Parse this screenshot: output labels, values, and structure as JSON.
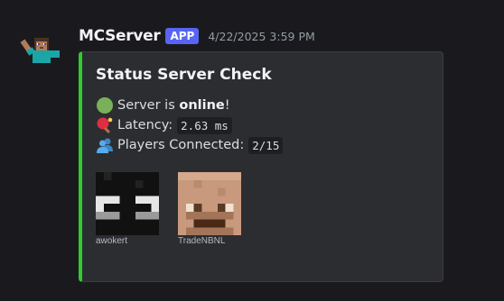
{
  "message": {
    "username": "MCServer",
    "badge": "APP",
    "timestamp": "4/22/2025 3:59 PM",
    "avatar_icon": "minecraft-steve-waving-icon"
  },
  "embed": {
    "accent_color": "#2ecc2f",
    "title": "Status Server Check",
    "status": {
      "icon": "green-circle-emoji",
      "prefix": "Server is ",
      "value": "online",
      "suffix": "!"
    },
    "latency": {
      "icon": "ping-pong-emoji",
      "label": "Latency:",
      "value": "2.63 ms"
    },
    "players": {
      "icon": "busts-in-silhouette-emoji",
      "label": "Players Connected:",
      "value": "2/15"
    },
    "player_list": [
      {
        "name": "awokert",
        "icon": "player-head-awokert"
      },
      {
        "name": "TradeNBNL",
        "icon": "player-head-tradenbnl"
      }
    ]
  }
}
